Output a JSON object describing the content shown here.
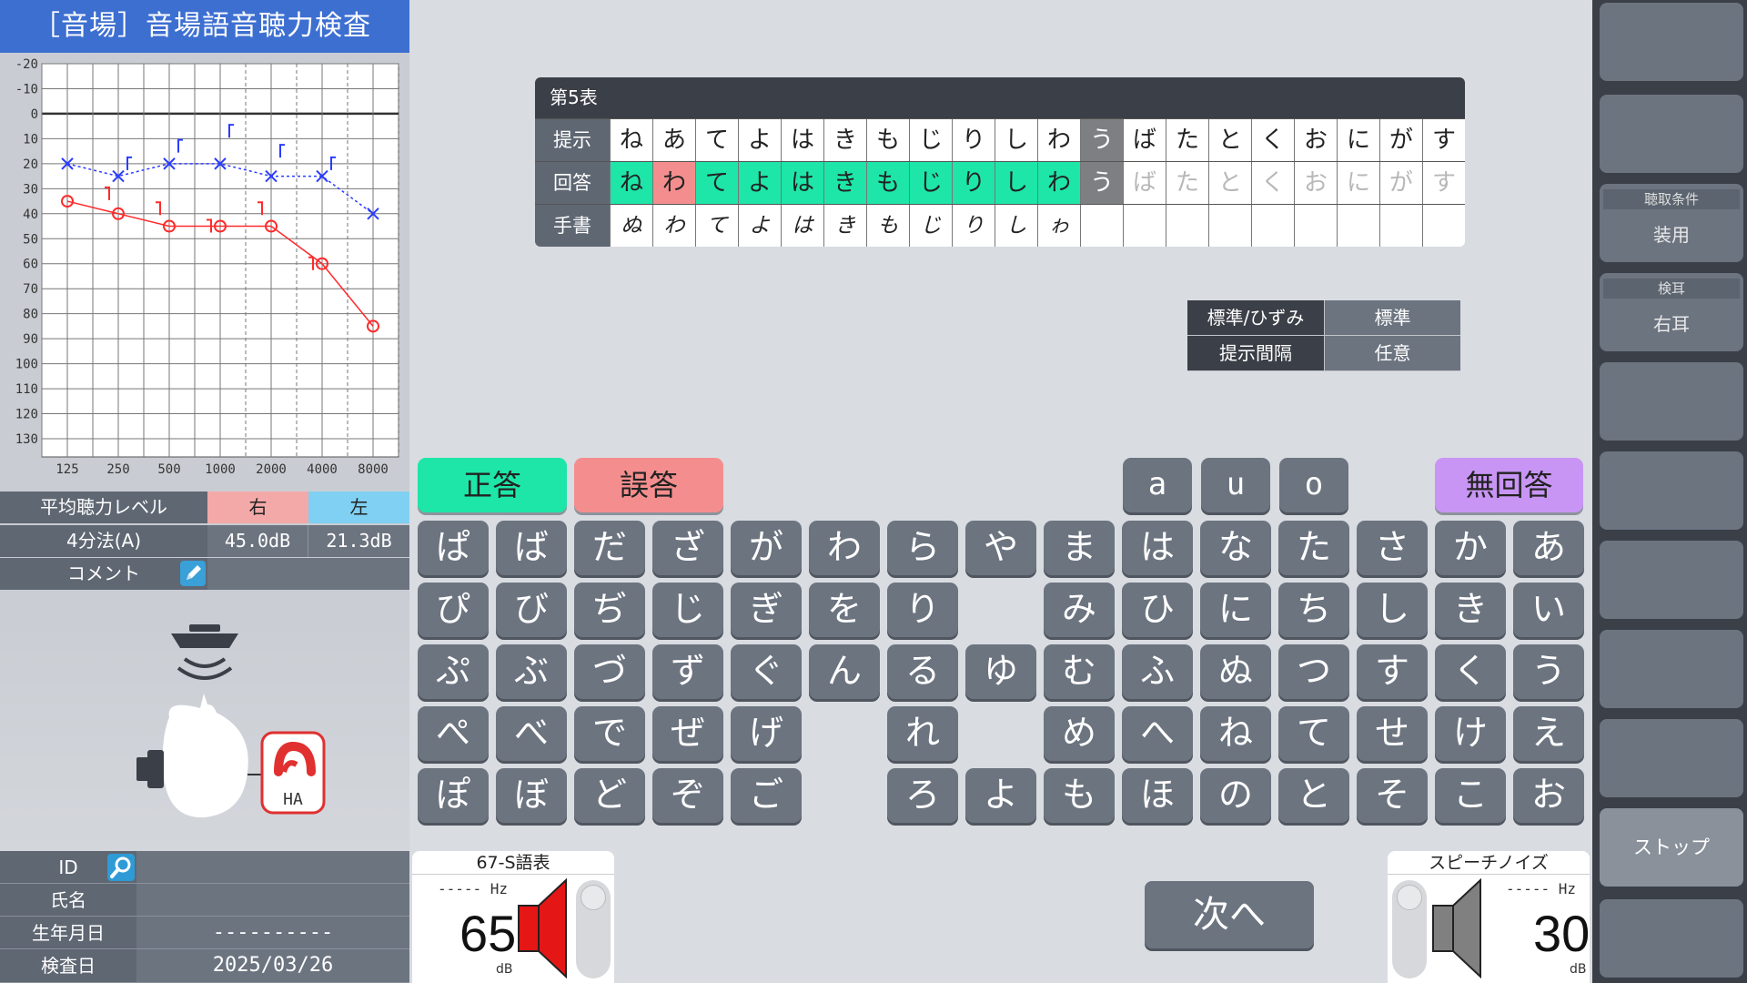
{
  "app_title": "［音場］音場語音聴力検査",
  "audiogram": {
    "y_ticks": [
      "-20",
      "-10",
      "0",
      "10",
      "20",
      "30",
      "40",
      "50",
      "60",
      "70",
      "80",
      "90",
      "100",
      "110",
      "120",
      "130"
    ],
    "x_ticks": [
      "125",
      "250",
      "500",
      "1000",
      "2000",
      "4000",
      "8000"
    ],
    "right_ear": [
      {
        "hz": 125,
        "db": 35
      },
      {
        "hz": 250,
        "db": 40
      },
      {
        "hz": 500,
        "db": 45
      },
      {
        "hz": 1000,
        "db": 45
      },
      {
        "hz": 2000,
        "db": 45
      },
      {
        "hz": 4000,
        "db": 60
      },
      {
        "hz": 8000,
        "db": 85
      }
    ],
    "left_ear": [
      {
        "hz": 125,
        "db": 20
      },
      {
        "hz": 250,
        "db": 25
      },
      {
        "hz": 500,
        "db": 20
      },
      {
        "hz": 1000,
        "db": 20
      },
      {
        "hz": 2000,
        "db": 25
      },
      {
        "hz": 4000,
        "db": 25
      },
      {
        "hz": 8000,
        "db": 40
      }
    ],
    "right_color": "#ff2a2a",
    "left_color": "#2a3cff"
  },
  "avg": {
    "header": "平均聴力レベル",
    "right_label": "右",
    "left_label": "左",
    "method": "4分法(A)",
    "right_value": "45.0dB",
    "left_value": "21.3dB",
    "comment_label": "コメント"
  },
  "ear": {
    "ha_label": "HA"
  },
  "patient": {
    "id_label": "ID",
    "id_value": "",
    "name_label": "氏名",
    "name_value": "",
    "birth_label": "生年月日",
    "birth_value": "----------",
    "date_label": "検査日",
    "date_value": "2025/03/26"
  },
  "table": {
    "title": "第5表",
    "row_labels": [
      "提示",
      "回答",
      "手書"
    ],
    "presented": [
      "ね",
      "あ",
      "て",
      "よ",
      "は",
      "き",
      "も",
      "じ",
      "り",
      "し",
      "わ",
      "う",
      "ば",
      "た",
      "と",
      "く",
      "お",
      "に",
      "が",
      "す"
    ],
    "answers": [
      "ね",
      "わ",
      "て",
      "よ",
      "は",
      "き",
      "も",
      "じ",
      "り",
      "し",
      "わ",
      "う",
      "ば",
      "た",
      "と",
      "く",
      "お",
      "に",
      "が",
      "す"
    ],
    "answer_states": [
      "correct",
      "wrong",
      "correct",
      "correct",
      "correct",
      "correct",
      "correct",
      "correct",
      "correct",
      "correct",
      "correct",
      "current",
      "pending",
      "pending",
      "pending",
      "pending",
      "pending",
      "pending",
      "pending",
      "pending"
    ],
    "handwritten": [
      "ぬ",
      "わ",
      "て",
      "よ",
      "は",
      "き",
      "も",
      "じ",
      "り",
      "し",
      "ゎ",
      "",
      "",
      "",
      "",
      "",
      "",
      "",
      "",
      ""
    ]
  },
  "conditions": {
    "rows": [
      {
        "key": "標準/ひずみ",
        "value": "標準"
      },
      {
        "key": "提示間隔",
        "value": "任意"
      }
    ]
  },
  "buttons": {
    "correct": "正答",
    "wrong": "誤答",
    "no_answer": "無回答",
    "next": "次へ",
    "vowels": [
      "a",
      "u",
      "o"
    ]
  },
  "keyboard": [
    [
      "ぱ",
      "ば",
      "だ",
      "ざ",
      "が",
      "わ",
      "ら",
      "や",
      "ま",
      "は",
      "な",
      "た",
      "さ",
      "か",
      "あ"
    ],
    [
      "ぴ",
      "び",
      "ぢ",
      "じ",
      "ぎ",
      "を",
      "り",
      "",
      "み",
      "ひ",
      "に",
      "ち",
      "し",
      "き",
      "い"
    ],
    [
      "ぷ",
      "ぶ",
      "づ",
      "ず",
      "ぐ",
      "ん",
      "る",
      "ゆ",
      "む",
      "ふ",
      "ぬ",
      "つ",
      "す",
      "く",
      "う"
    ],
    [
      "ぺ",
      "べ",
      "で",
      "ぜ",
      "げ",
      "",
      "れ",
      "",
      "め",
      "へ",
      "ね",
      "て",
      "せ",
      "け",
      "え"
    ],
    [
      "ぽ",
      "ぼ",
      "ど",
      "ぞ",
      "ご",
      "",
      "ろ",
      "よ",
      "も",
      "ほ",
      "の",
      "と",
      "そ",
      "こ",
      "お"
    ]
  ],
  "speech": {
    "title": "67-S語表",
    "hz": "----- Hz",
    "db": "65",
    "unit": "dB"
  },
  "noise": {
    "title": "スピーチノイズ",
    "hz": "----- Hz",
    "db": "30",
    "unit": "dB"
  },
  "sidebar": {
    "listening_title": "聴取条件",
    "listening_value": "装用",
    "ear_title": "検耳",
    "ear_value": "右耳",
    "stop": "ストップ"
  }
}
